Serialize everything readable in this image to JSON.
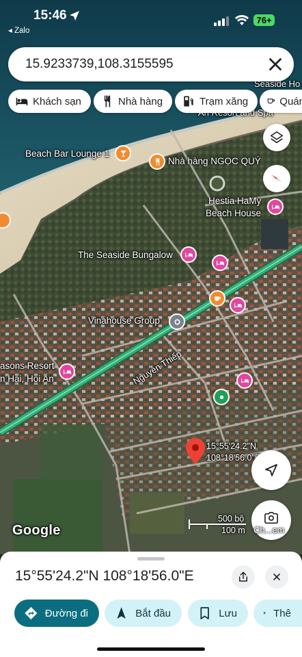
{
  "status_bar": {
    "time": "15:46",
    "back_app": "◂ Zalo",
    "battery": "76+"
  },
  "search": {
    "value": "15.9233739,108.3155595",
    "clear_icon": "close-icon"
  },
  "chips": [
    {
      "label": "Khách sạn",
      "icon": "bed-icon"
    },
    {
      "label": "Nhà hàng",
      "icon": "fork-knife-icon"
    },
    {
      "label": "Trạm xăng",
      "icon": "gas-station-icon"
    },
    {
      "label": "Quán",
      "icon": "coffee-icon"
    }
  ],
  "map_labels": {
    "beach_bar": "Beach Bar Lounge 1",
    "ngoc_quy": "Nhà hàng NGỌC QUÝ",
    "hestia_1": "Hestia HaMy",
    "hestia_2": "Beach House",
    "seaside_bungalow": "The Seaside Bungalow",
    "vinahouse": "Vinahouse Group",
    "seasons_1": "asons Resort",
    "seasons_2": "n Hai, Hoi An",
    "street": "Nguyễn Thiếp",
    "top_right_1": "Seaside Ho",
    "top_right_2": "An Resort and Spa",
    "coord_lat": "15°55'24.2\"N",
    "coord_lng": "108°18'56.0\"E",
    "google": "Google",
    "scale_bo": "500 bộ",
    "scale_m": "100 m",
    "screenshot_btn": "Ch...em"
  },
  "sheet": {
    "title": "15°55'24.2\"N 108°18'56.0\"E",
    "actions": [
      {
        "label": "Đường đi",
        "icon": "directions-icon"
      },
      {
        "label": "Bắt đầu",
        "icon": "navigation-arrow-icon"
      },
      {
        "label": "Lưu",
        "icon": "bookmark-icon"
      },
      {
        "label": "Thê",
        "icon": "flag-icon"
      }
    ]
  },
  "colors": {
    "accent": "#0b57d0",
    "primary_button": "#0b6e80",
    "secondary_button": "#d3f2f7",
    "hotel_pin": "#e0479e",
    "food_pin": "#f28b30",
    "road_green": "#34b27b",
    "marker_red": "#ea4335"
  }
}
